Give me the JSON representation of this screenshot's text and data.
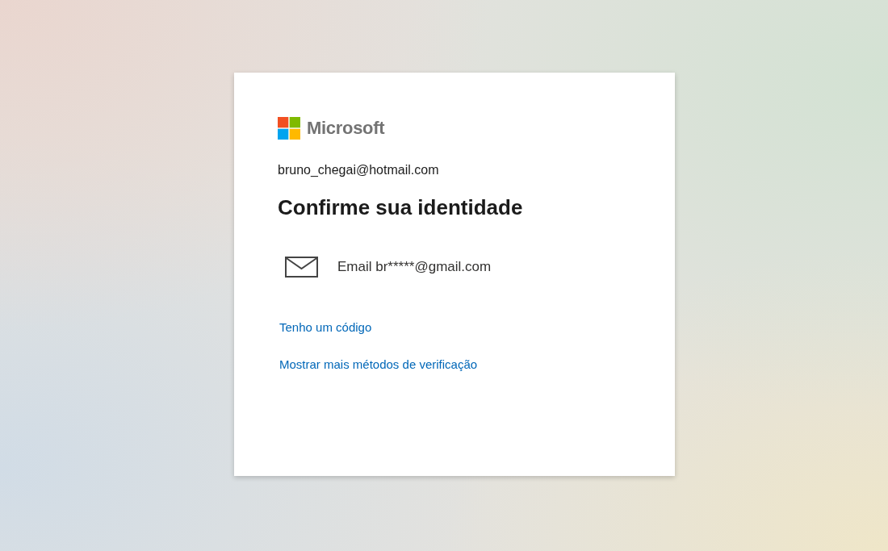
{
  "logo": {
    "wordmark": "Microsoft"
  },
  "account": "bruno_chegai@hotmail.com",
  "title": "Confirme sua identidade",
  "options": [
    {
      "kind": "email",
      "label": "Email br*****@gmail.com"
    }
  ],
  "links": [
    "Tenho um código",
    "Mostrar mais métodos de verificação"
  ]
}
